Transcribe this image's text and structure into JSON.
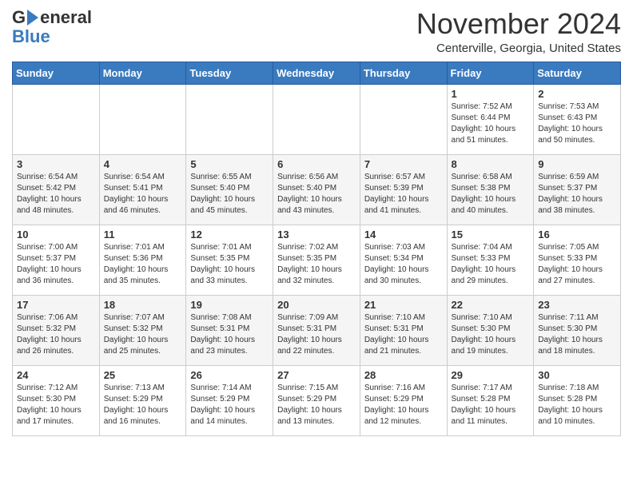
{
  "logo": {
    "general": "General",
    "blue": "Blue"
  },
  "header": {
    "title": "November 2024",
    "location": "Centerville, Georgia, United States"
  },
  "weekdays": [
    "Sunday",
    "Monday",
    "Tuesday",
    "Wednesday",
    "Thursday",
    "Friday",
    "Saturday"
  ],
  "weeks": [
    [
      {
        "day": "",
        "info": ""
      },
      {
        "day": "",
        "info": ""
      },
      {
        "day": "",
        "info": ""
      },
      {
        "day": "",
        "info": ""
      },
      {
        "day": "",
        "info": ""
      },
      {
        "day": "1",
        "info": "Sunrise: 7:52 AM\nSunset: 6:44 PM\nDaylight: 10 hours\nand 51 minutes."
      },
      {
        "day": "2",
        "info": "Sunrise: 7:53 AM\nSunset: 6:43 PM\nDaylight: 10 hours\nand 50 minutes."
      }
    ],
    [
      {
        "day": "3",
        "info": "Sunrise: 6:54 AM\nSunset: 5:42 PM\nDaylight: 10 hours\nand 48 minutes."
      },
      {
        "day": "4",
        "info": "Sunrise: 6:54 AM\nSunset: 5:41 PM\nDaylight: 10 hours\nand 46 minutes."
      },
      {
        "day": "5",
        "info": "Sunrise: 6:55 AM\nSunset: 5:40 PM\nDaylight: 10 hours\nand 45 minutes."
      },
      {
        "day": "6",
        "info": "Sunrise: 6:56 AM\nSunset: 5:40 PM\nDaylight: 10 hours\nand 43 minutes."
      },
      {
        "day": "7",
        "info": "Sunrise: 6:57 AM\nSunset: 5:39 PM\nDaylight: 10 hours\nand 41 minutes."
      },
      {
        "day": "8",
        "info": "Sunrise: 6:58 AM\nSunset: 5:38 PM\nDaylight: 10 hours\nand 40 minutes."
      },
      {
        "day": "9",
        "info": "Sunrise: 6:59 AM\nSunset: 5:37 PM\nDaylight: 10 hours\nand 38 minutes."
      }
    ],
    [
      {
        "day": "10",
        "info": "Sunrise: 7:00 AM\nSunset: 5:37 PM\nDaylight: 10 hours\nand 36 minutes."
      },
      {
        "day": "11",
        "info": "Sunrise: 7:01 AM\nSunset: 5:36 PM\nDaylight: 10 hours\nand 35 minutes."
      },
      {
        "day": "12",
        "info": "Sunrise: 7:01 AM\nSunset: 5:35 PM\nDaylight: 10 hours\nand 33 minutes."
      },
      {
        "day": "13",
        "info": "Sunrise: 7:02 AM\nSunset: 5:35 PM\nDaylight: 10 hours\nand 32 minutes."
      },
      {
        "day": "14",
        "info": "Sunrise: 7:03 AM\nSunset: 5:34 PM\nDaylight: 10 hours\nand 30 minutes."
      },
      {
        "day": "15",
        "info": "Sunrise: 7:04 AM\nSunset: 5:33 PM\nDaylight: 10 hours\nand 29 minutes."
      },
      {
        "day": "16",
        "info": "Sunrise: 7:05 AM\nSunset: 5:33 PM\nDaylight: 10 hours\nand 27 minutes."
      }
    ],
    [
      {
        "day": "17",
        "info": "Sunrise: 7:06 AM\nSunset: 5:32 PM\nDaylight: 10 hours\nand 26 minutes."
      },
      {
        "day": "18",
        "info": "Sunrise: 7:07 AM\nSunset: 5:32 PM\nDaylight: 10 hours\nand 25 minutes."
      },
      {
        "day": "19",
        "info": "Sunrise: 7:08 AM\nSunset: 5:31 PM\nDaylight: 10 hours\nand 23 minutes."
      },
      {
        "day": "20",
        "info": "Sunrise: 7:09 AM\nSunset: 5:31 PM\nDaylight: 10 hours\nand 22 minutes."
      },
      {
        "day": "21",
        "info": "Sunrise: 7:10 AM\nSunset: 5:31 PM\nDaylight: 10 hours\nand 21 minutes."
      },
      {
        "day": "22",
        "info": "Sunrise: 7:10 AM\nSunset: 5:30 PM\nDaylight: 10 hours\nand 19 minutes."
      },
      {
        "day": "23",
        "info": "Sunrise: 7:11 AM\nSunset: 5:30 PM\nDaylight: 10 hours\nand 18 minutes."
      }
    ],
    [
      {
        "day": "24",
        "info": "Sunrise: 7:12 AM\nSunset: 5:30 PM\nDaylight: 10 hours\nand 17 minutes."
      },
      {
        "day": "25",
        "info": "Sunrise: 7:13 AM\nSunset: 5:29 PM\nDaylight: 10 hours\nand 16 minutes."
      },
      {
        "day": "26",
        "info": "Sunrise: 7:14 AM\nSunset: 5:29 PM\nDaylight: 10 hours\nand 14 minutes."
      },
      {
        "day": "27",
        "info": "Sunrise: 7:15 AM\nSunset: 5:29 PM\nDaylight: 10 hours\nand 13 minutes."
      },
      {
        "day": "28",
        "info": "Sunrise: 7:16 AM\nSunset: 5:29 PM\nDaylight: 10 hours\nand 12 minutes."
      },
      {
        "day": "29",
        "info": "Sunrise: 7:17 AM\nSunset: 5:28 PM\nDaylight: 10 hours\nand 11 minutes."
      },
      {
        "day": "30",
        "info": "Sunrise: 7:18 AM\nSunset: 5:28 PM\nDaylight: 10 hours\nand 10 minutes."
      }
    ]
  ]
}
